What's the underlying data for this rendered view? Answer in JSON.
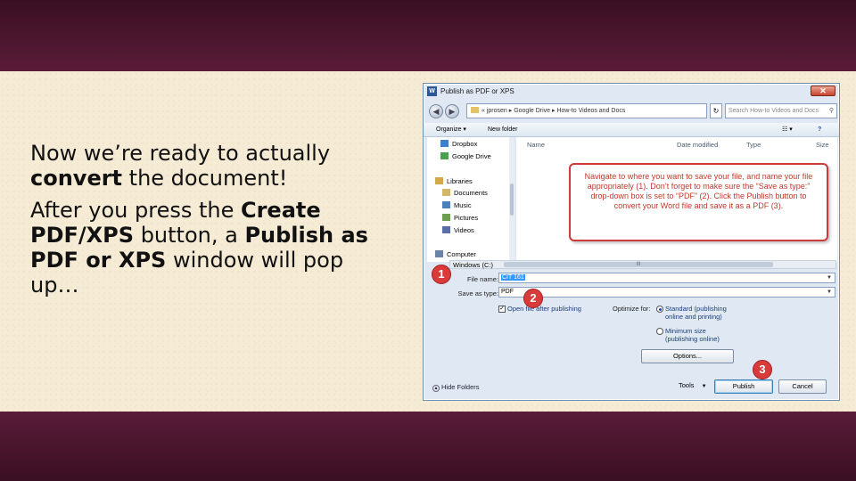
{
  "slide": {
    "para1_a": "Now we’re ready to actually ",
    "para1_bold": "convert",
    "para1_b": " the document!",
    "para2_a": "After you press the ",
    "para2_bold1": "Create PDF/XPS",
    "para2_b": " button, a ",
    "para2_bold2": "Publish as PDF or XPS",
    "para2_c": " window will pop up…"
  },
  "dialog": {
    "title": "Publish as PDF or XPS",
    "app_icon": "W",
    "close_glyph": "✕",
    "back_glyph": "◀",
    "forward_glyph": "▶",
    "address": "« jprosen ▸ Google Drive ▸ How-to Videos and Docs",
    "address_dropdown": "▾",
    "refresh_glyph": "↻",
    "search_placeholder": "Search How-to Videos and Docs",
    "toolbar": {
      "organize": "Organize ▾",
      "new_folder": "New folder",
      "view": "☷ ▾",
      "help": "?"
    },
    "nav_items": [
      {
        "label": "Dropbox",
        "color": "#3b7fd1"
      },
      {
        "label": "Google Drive",
        "color": "#4aa34a"
      },
      {
        "label": "Libraries",
        "color": "#d5a84a"
      },
      {
        "label": "Documents",
        "color": "#d5b76a"
      },
      {
        "label": "Music",
        "color": "#4d7fbf"
      },
      {
        "label": "Pictures",
        "color": "#6e9e4f"
      },
      {
        "label": "Videos",
        "color": "#5a6fa8"
      },
      {
        "label": "Computer",
        "color": "#6a85a8"
      }
    ],
    "tree_drive": "Windows (C:)",
    "columns": {
      "name": "Name",
      "date": "Date modified",
      "type": "Type",
      "size": "Size"
    },
    "hscroll_grip": "III",
    "callout": "Navigate to where you want to save your file, and name your file appropriately (1). Don’t forget to make sure the “Save as type:” drop-down box is set to “PDF” (2). Click the Publish button to convert your Word file and save it as a PDF (3).",
    "file_name_label": "File name:",
    "file_name_value": "CIT 161",
    "save_type_label": "Save as type:",
    "save_type_value": "PDF",
    "open_after": "Open file after publishing",
    "open_after_check": "✓",
    "optimize_label": "Optimize for:",
    "opt_standard": "Standard (publishing online and printing)",
    "opt_minimum": "Minimum size (publishing online)",
    "options_btn": "Options...",
    "hide_folders": "Hide Folders",
    "tools": "Tools",
    "tools_arrow": "▼",
    "publish_btn": "Publish",
    "cancel_btn": "Cancel",
    "badges": [
      "1",
      "2",
      "3"
    ]
  }
}
